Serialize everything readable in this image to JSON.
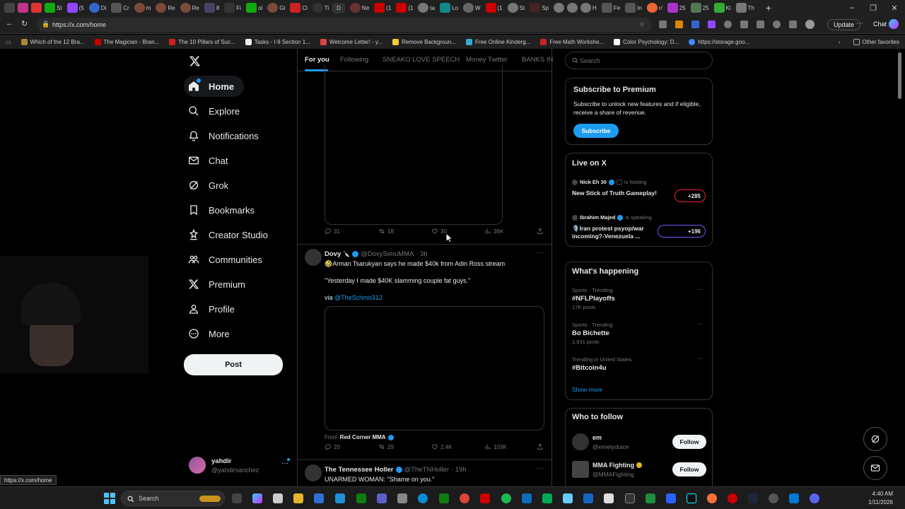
{
  "browser": {
    "tabs_text": [
      "St",
      "(5",
      "Di",
      "Cr",
      "m",
      "Re",
      "Re",
      "8",
      "Fi",
      "ol",
      "Gi",
      "Cl",
      "Ti",
      "D",
      "Ne",
      "(1",
      "(1",
      "ta",
      "Lo",
      "W",
      "(1",
      "St",
      "Sp",
      "H",
      "Fe",
      "In",
      "r/",
      "25",
      "25",
      "Ki",
      "Th"
    ],
    "url": "https://x.com/home",
    "update_label": "Update",
    "chat_label": "Chat",
    "bookmarks": [
      "Which of the 12 Bra...",
      "The Magician - Bran...",
      "The 10 Pillars of Suc...",
      "Tasks - I-9 Section 1...",
      "Welcome Letter! - y...",
      "Remove Backgroun...",
      "Free Online Kinderg...",
      "Free Math Workshe...",
      "Color Psychology: D...",
      "https://storage.goo..."
    ],
    "other_favorites": "Other favorites",
    "status_url": "https://x.com/home"
  },
  "sidebar": {
    "items": [
      {
        "label": "Home",
        "icon": "home-icon"
      },
      {
        "label": "Explore",
        "icon": "search-icon"
      },
      {
        "label": "Notifications",
        "icon": "bell-icon"
      },
      {
        "label": "Chat",
        "icon": "mail-icon"
      },
      {
        "label": "Grok",
        "icon": "grok-icon"
      },
      {
        "label": "Bookmarks",
        "icon": "bookmark-icon"
      },
      {
        "label": "Creator Studio",
        "icon": "creator-studio-icon"
      },
      {
        "label": "Communities",
        "icon": "communities-icon"
      },
      {
        "label": "Premium",
        "icon": "x-logo-icon"
      },
      {
        "label": "Profile",
        "icon": "person-icon"
      },
      {
        "label": "More",
        "icon": "more-icon"
      }
    ],
    "post_label": "Post",
    "account": {
      "name": "yahdir",
      "handle": "@yahdirsanchez"
    }
  },
  "tabs": [
    "For you",
    "Following",
    "SNEAKO LOVE SPEECH",
    "Money Twitter",
    "BANKS IN"
  ],
  "feed": {
    "tweet0_actions": {
      "replies": "31",
      "reposts": "18",
      "likes": "30",
      "views": "36K"
    },
    "tweet1": {
      "name": "Dovy",
      "handle": "@DovySimuMMA",
      "time": "· 3h",
      "text1": "🤣Arman Tsarukyan says he made $40k from Adin Ross stream",
      "text2": "\"Yesterday I made $40K slamming couple fat guys.\"",
      "via_prefix": "via",
      "via_handle": "@TheSchmo312",
      "from_prefix": "From",
      "from_name": "Red Corner MMA",
      "actions": {
        "replies": "20",
        "reposts": "29",
        "likes": "2.4K",
        "views": "103K"
      }
    },
    "tweet2": {
      "name": "The Tennessee Holler",
      "handle": "@TheTNHoller",
      "time": "· 19h",
      "text": "UNARMED WOMAN: \"Shame on you.\""
    }
  },
  "right": {
    "search_placeholder": "Search",
    "premium": {
      "title": "Subscribe to Premium",
      "body": "Subscribe to unlock new features and if eligible, receive a share of revenue.",
      "button": "Subscribe"
    },
    "live": {
      "title": "Live on X",
      "items": [
        {
          "host": "Nick Eh 30",
          "status": "is hosting",
          "title": "New Stick of Truth Gameplay!",
          "count": "+285"
        },
        {
          "host": "Ibrahim Majed",
          "status": "is speaking",
          "title": "🎙️Iran protest psyop/war incoming?-Venezuela ...",
          "count": "+196"
        }
      ]
    },
    "happening": {
      "title": "What's happening",
      "items": [
        {
          "cat": "Sports · Trending",
          "name": "#NFLPlayoffs",
          "count": "17K posts"
        },
        {
          "cat": "Sports · Trending",
          "name": "Bo Bichette",
          "count": "1,931 posts"
        },
        {
          "cat": "Trending in United States",
          "name": "#Bitcoin4u",
          "count": ""
        }
      ],
      "show_more": "Show more"
    },
    "follow": {
      "title": "Who to follow",
      "items": [
        {
          "name": "em",
          "handle": "@emelyduice",
          "button": "Follow"
        },
        {
          "name": "MMA Fighting",
          "handle": "@MMAFighting",
          "button": "Follow"
        }
      ]
    }
  },
  "taskbar": {
    "search": "Search",
    "time": "4:40 AM",
    "date": "1/11/2026"
  },
  "colors": {
    "accent": "#1d9bf0",
    "bg": "#000000",
    "border": "#2f3336",
    "muted": "#71767b"
  }
}
